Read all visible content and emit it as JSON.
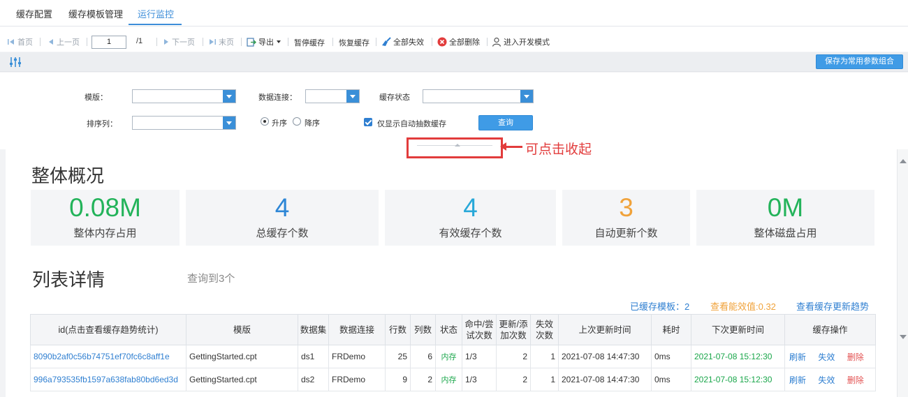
{
  "tabs": [
    "缓存配置",
    "缓存模板管理",
    "运行监控"
  ],
  "toolbar": {
    "first": "首页",
    "prev": "上一页",
    "page": "1",
    "total": "/1",
    "next": "下一页",
    "last": "末页",
    "export": "导出",
    "pause": "暂停缓存",
    "resume": "恢复缓存",
    "invalidate_all": "全部失效",
    "delete_all": "全部删除",
    "dev_mode": "进入开发模式"
  },
  "params_bar": {
    "save_label": "保存为常用参数组合"
  },
  "form": {
    "template_label": "模版：",
    "template_value": "",
    "conn_label": "数据连接：",
    "conn_value": "",
    "status_label": "缓存状态",
    "status_value": "",
    "sort_label": "排序列：",
    "sort_value": "",
    "asc": "升序",
    "desc": "降序",
    "order_selected": "asc",
    "auto_only": "仅显示自动抽数缓存",
    "auto_only_checked": true,
    "query": "查询"
  },
  "annotation": "可点击收起",
  "overview": {
    "title": "整体概况",
    "cards": [
      {
        "value": "0.08M",
        "label": "整体内存占用",
        "color": "#23b35a"
      },
      {
        "value": "4",
        "label": "总缓存个数",
        "color": "#2d86d6"
      },
      {
        "value": "4",
        "label": "有效缓存个数",
        "color": "#28a8d8"
      },
      {
        "value": "3",
        "label": "自动更新个数",
        "color": "#f0a23a"
      },
      {
        "value": "0M",
        "label": "整体磁盘占用",
        "color": "#23b35a"
      }
    ]
  },
  "list": {
    "title": "列表详情",
    "count": "查询到3个",
    "cached_templates": "已缓存模板：2",
    "efficiency": "查看能效值:0.32",
    "trend": "查看缓存更新趋势",
    "columns": [
      "id(点击查看缓存趋势统计)",
      "模版",
      "数据集",
      "数据连接",
      "行数",
      "列数",
      "状态",
      "命中/尝试次数",
      "更新/添加次数",
      "失效次数",
      "上次更新时间",
      "耗时",
      "下次更新时间",
      "缓存操作"
    ],
    "rows": [
      {
        "id": "8090b2af0c56b74751ef70fc6c8aff1e",
        "template": "GettingStarted.cpt",
        "dataset": "ds1",
        "conn": "FRDemo",
        "rows": "25",
        "cols": "6",
        "status": "内存",
        "hit": "1/3",
        "update": "2",
        "invalid": "1",
        "last": "2021-07-08 14:47:30",
        "cost": "0ms",
        "next": "2021-07-08 15:12:30",
        "refresh": "刷新",
        "invalidate": "失效",
        "delete": "删除"
      },
      {
        "id": "996a793535fb1597a638fab80bd6ed3d",
        "template": "GettingStarted.cpt",
        "dataset": "ds2",
        "conn": "FRDemo",
        "rows": "9",
        "cols": "2",
        "status": "内存",
        "hit": "1/3",
        "update": "2",
        "invalid": "1",
        "last": "2021-07-08 14:47:30",
        "cost": "0ms",
        "next": "2021-07-08 15:12:30",
        "refresh": "刷新",
        "invalidate": "失效",
        "delete": "删除"
      }
    ]
  }
}
